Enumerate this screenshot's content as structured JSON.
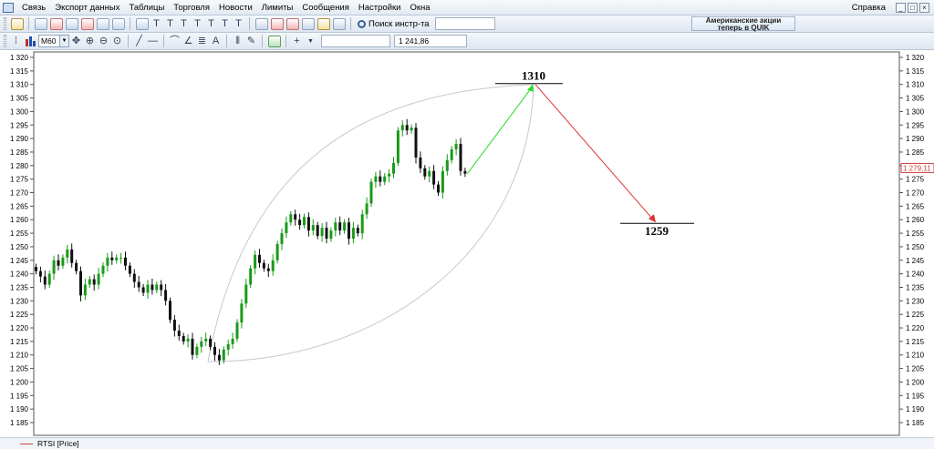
{
  "menu": {
    "items": [
      "Связь",
      "Экспорт данных",
      "Таблицы",
      "Торговля",
      "Новости",
      "Лимиты",
      "Сообщения",
      "Настройки",
      "Окна"
    ],
    "help": "Справка"
  },
  "toolbar": {
    "search_label": "Поиск инстр-та",
    "promo_line1": "Американские акции",
    "promo_line2": "теперь в QUIK",
    "timeframe": "M60",
    "cursor_price": "1 241,86"
  },
  "chart": {
    "instrument_legend": "RTSI [Price]",
    "current_price_label": "1 279,11",
    "target_up_label": "1310",
    "target_down_label": "1259",
    "colors": {
      "up_candle": "#1a9a1a",
      "down_candle": "#111111",
      "up_arrow": "#22dd22",
      "down_arrow": "#e03030",
      "ellipse": "#c8c8c8",
      "legend_line": "#d04040"
    }
  },
  "chart_data": {
    "type": "candlestick",
    "ylim": [
      1185,
      1320
    ],
    "ytick_step": 5,
    "ytick_labels": [
      "1 320",
      "1 315",
      "1 310",
      "1 305",
      "1 300",
      "1 295",
      "1 290",
      "1 285",
      "1 280",
      "1 275",
      "1 270",
      "1 265",
      "1 260",
      "1 255",
      "1 250",
      "1 245",
      "1 240",
      "1 235",
      "1 230",
      "1 225",
      "1 220",
      "1 215",
      "1 210",
      "1 205",
      "1 200",
      "1 195",
      "1 190",
      "1 185"
    ],
    "series": [
      {
        "name": "RTSI [Price]"
      }
    ],
    "close_path": [
      1241,
      1239,
      1236,
      1240,
      1245,
      1243,
      1246,
      1249,
      1244,
      1241,
      1232,
      1236,
      1238,
      1236,
      1240,
      1243,
      1246,
      1245,
      1246,
      1246,
      1243,
      1240,
      1237,
      1235,
      1233,
      1236,
      1234,
      1236,
      1234,
      1230,
      1223,
      1219,
      1217,
      1215,
      1216,
      1210,
      1213,
      1215,
      1216,
      1213,
      1210,
      1208,
      1212,
      1214,
      1216,
      1222,
      1229,
      1236,
      1242,
      1247,
      1244,
      1242,
      1241,
      1245,
      1251,
      1255,
      1259,
      1262,
      1260,
      1258,
      1261,
      1256,
      1258,
      1254,
      1257,
      1253,
      1256,
      1259,
      1256,
      1259,
      1253,
      1257,
      1255,
      1262,
      1266,
      1274,
      1276,
      1274,
      1276,
      1277,
      1281,
      1293,
      1295,
      1293,
      1294,
      1283,
      1279,
      1276,
      1278,
      1273,
      1270,
      1278,
      1282,
      1286,
      1288,
      1278,
      1277
    ],
    "annotations": {
      "current_price": 1279.11,
      "target_up": 1310,
      "target_down": 1259
    }
  }
}
